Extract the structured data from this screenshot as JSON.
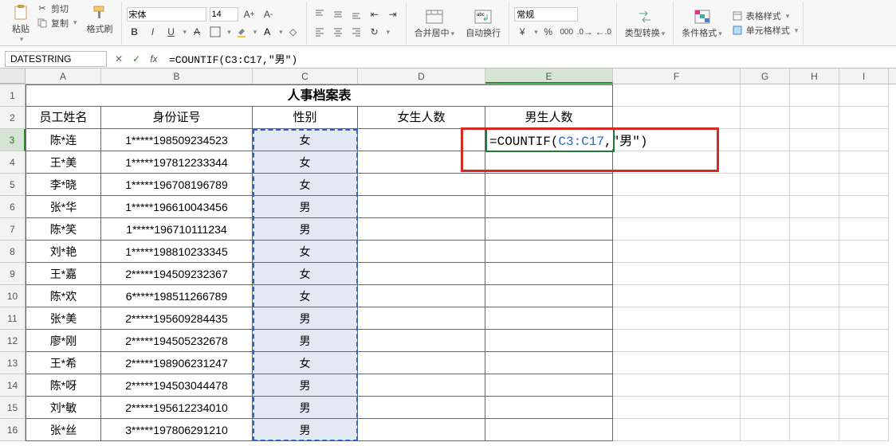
{
  "toolbar": {
    "paste_label": "粘贴",
    "cut_label": "剪切",
    "copy_label": "复制",
    "format_painter_label": "格式刷",
    "font_name": "宋体",
    "font_size": "14",
    "merge_center_label": "合并居中",
    "wrap_text_label": "自动换行",
    "number_format": "常规",
    "type_convert_label": "类型转换",
    "cond_format_label": "条件格式",
    "table_style_label": "表格样式",
    "cell_style_label": "单元格样式"
  },
  "formula_bar": {
    "name_box": "DATESTRING",
    "formula": "=COUNTIF(C3:C17,\"男\")"
  },
  "columns": [
    "A",
    "B",
    "C",
    "D",
    "E",
    "F",
    "G",
    "H",
    "I"
  ],
  "row_numbers": [
    1,
    2,
    3,
    4,
    5,
    6,
    7,
    8,
    9,
    10,
    11,
    12,
    13,
    14,
    15,
    16
  ],
  "sheet": {
    "title": "人事档案表",
    "headers": {
      "name": "员工姓名",
      "id": "身份证号",
      "gender": "性别",
      "female_count": "女生人数",
      "male_count": "男生人数"
    },
    "formula_display_prefix": "=COUNTIF(",
    "formula_display_ref": "C3:C17",
    "formula_display_suffix": ",\"男\")",
    "rows": [
      {
        "name": "陈*连",
        "id": "1*****198509234523",
        "gender": "女"
      },
      {
        "name": "王*美",
        "id": "1*****197812233344",
        "gender": "女"
      },
      {
        "name": "李*晓",
        "id": "1*****196708196789",
        "gender": "女"
      },
      {
        "name": "张*华",
        "id": "1*****196610043456",
        "gender": "男"
      },
      {
        "name": "陈*笑",
        "id": "1*****196710111234",
        "gender": "男"
      },
      {
        "name": "刘*艳",
        "id": "1*****198810233345",
        "gender": "女"
      },
      {
        "name": "王*嘉",
        "id": "2*****194509232367",
        "gender": "女"
      },
      {
        "name": "陈*欢",
        "id": "6*****198511266789",
        "gender": "女"
      },
      {
        "name": "张*美",
        "id": "2*****195609284435",
        "gender": "男"
      },
      {
        "name": "廖*刚",
        "id": "2*****194505232678",
        "gender": "男"
      },
      {
        "name": "王*希",
        "id": "2*****198906231247",
        "gender": "女"
      },
      {
        "name": "陈*呀",
        "id": "2*****194503044478",
        "gender": "男"
      },
      {
        "name": "刘*敏",
        "id": "2*****195612234010",
        "gender": "男"
      },
      {
        "name": "张*丝",
        "id": "3*****197806291210",
        "gender": "男"
      }
    ]
  }
}
